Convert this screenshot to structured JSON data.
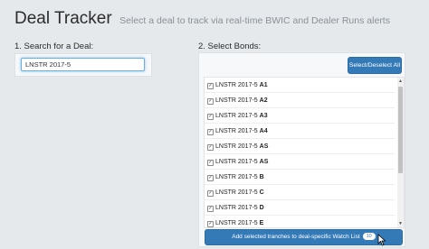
{
  "header": {
    "title": "Deal Tracker",
    "subtitle": "Select a deal to track via real-time BWIC and Dealer Runs alerts"
  },
  "search": {
    "label": "1. Search for a Deal:",
    "value": "LNSTR 2017-5"
  },
  "bonds": {
    "label": "2. Select Bonds:",
    "select_all_label": "Select/Deselect All",
    "items": [
      {
        "deal": "LNSTR 2017-5",
        "tranche": "A1",
        "checked": true
      },
      {
        "deal": "LNSTR 2017-5",
        "tranche": "A2",
        "checked": true
      },
      {
        "deal": "LNSTR 2017-5",
        "tranche": "A3",
        "checked": true
      },
      {
        "deal": "LNSTR 2017-5",
        "tranche": "A4",
        "checked": true
      },
      {
        "deal": "LNSTR 2017-5",
        "tranche": "AS",
        "checked": true
      },
      {
        "deal": "LNSTR 2017-5",
        "tranche": "AS",
        "checked": true
      },
      {
        "deal": "LNSTR 2017-5",
        "tranche": "B",
        "checked": true
      },
      {
        "deal": "LNSTR 2017-5",
        "tranche": "C",
        "checked": true
      },
      {
        "deal": "LNSTR 2017-5",
        "tranche": "D",
        "checked": true
      },
      {
        "deal": "LNSTR 2017-5",
        "tranche": "E",
        "checked": true
      }
    ],
    "add_button_label": "Add selected tranches to deal-specific Watch List",
    "add_button_count": "10"
  },
  "colors": {
    "primary_button": "#337ab7",
    "background": "#e5e9ec",
    "focus_border": "#66afe9"
  },
  "icons": {
    "checkbox": "check-mark",
    "scroll_up": "triangle-up",
    "scroll_down": "triangle-down",
    "cursor": "mouse-pointer"
  }
}
